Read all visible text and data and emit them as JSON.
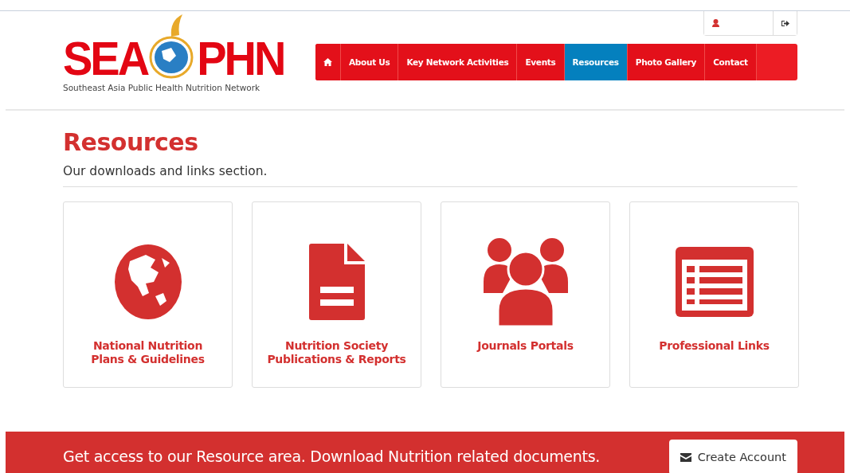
{
  "logo": {
    "left": "SEA",
    "right": "PHN",
    "tagline": "Southeast Asia Public Health Nutrition Network"
  },
  "nav": [
    {
      "kind": "home",
      "selected": false
    },
    {
      "kind": "text",
      "label": "About Us",
      "selected": false
    },
    {
      "kind": "text",
      "label": "Key Network Activities",
      "selected": false
    },
    {
      "kind": "text",
      "label": "Events",
      "selected": false
    },
    {
      "kind": "text",
      "label": "Resources",
      "selected": true
    },
    {
      "kind": "text",
      "label": "Photo Gallery",
      "selected": false
    },
    {
      "kind": "text",
      "label": "Contact",
      "selected": false
    }
  ],
  "page": {
    "title": "Resources",
    "subtitle": "Our downloads and links section."
  },
  "cards": [
    {
      "kind": "globe",
      "label": "National Nutrition Plans & Guidelines"
    },
    {
      "kind": "document",
      "label": "Nutrition Society Publications & Reports"
    },
    {
      "kind": "people",
      "label": "Journals Portals"
    },
    {
      "kind": "list",
      "label": "Professional Links"
    }
  ],
  "banner": {
    "text": "Get access to our Resource area. Download Nutrition related documents.",
    "button": "Create Account"
  }
}
